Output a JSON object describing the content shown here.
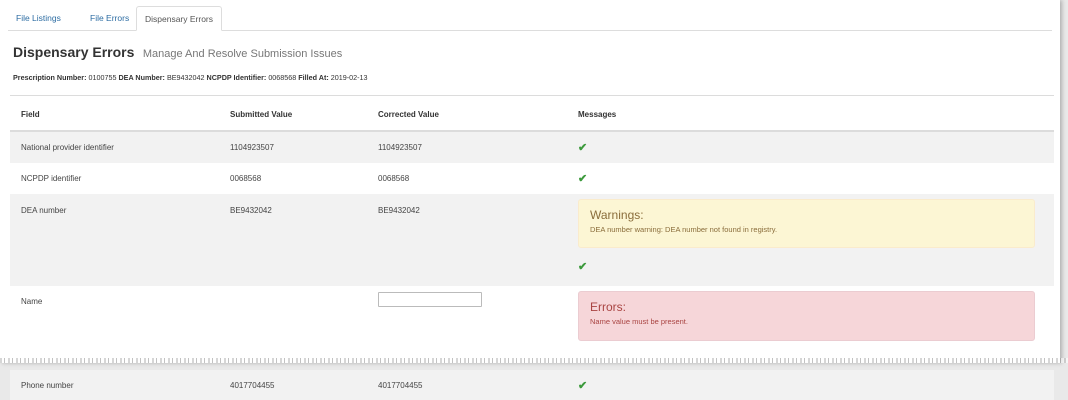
{
  "tabs": [
    {
      "label": "File Listings",
      "active": false
    },
    {
      "label": "File Errors",
      "active": false
    },
    {
      "label": "Dispensary Errors",
      "active": true
    }
  ],
  "heading": {
    "title": "Dispensary Errors",
    "subtitle": "Manage And Resolve Submission Issues"
  },
  "info": {
    "prescription_label": "Prescription Number:",
    "prescription_value": "0100755",
    "dea_label": "DEA Number:",
    "dea_value": "BE9432042",
    "ncpdp_label": "NCPDP Identifier:",
    "ncpdp_value": "0068568",
    "filled_label": "Filled At:",
    "filled_value": "2019-02-13"
  },
  "table": {
    "headers": [
      "Field",
      "Submitted Value",
      "Corrected Value",
      "Messages"
    ],
    "rows": [
      {
        "field": "National provider identifier",
        "submitted": "1104923507",
        "corrected": "1104923507"
      },
      {
        "field": "NCPDP identifier",
        "submitted": "0068568",
        "corrected": "0068568"
      },
      {
        "field": "DEA number",
        "submitted": "BE9432042",
        "corrected": "BE9432042",
        "warning_title": "Warnings:",
        "warning_msg": "DEA number warning: DEA number not found in registry."
      },
      {
        "field": "Name",
        "submitted": "",
        "corrected": "",
        "error_title": "Errors:",
        "error_msg": "Name value must be present."
      },
      {
        "field": "Phone number",
        "submitted": "4017704455",
        "corrected": "4017704455"
      }
    ]
  },
  "icons": {
    "check": "check-icon"
  },
  "colors": {
    "link": "#2d6da3",
    "success": "#3c9a3c",
    "warning_bg": "#fcf6d4",
    "error_bg": "#f6d6d9"
  }
}
